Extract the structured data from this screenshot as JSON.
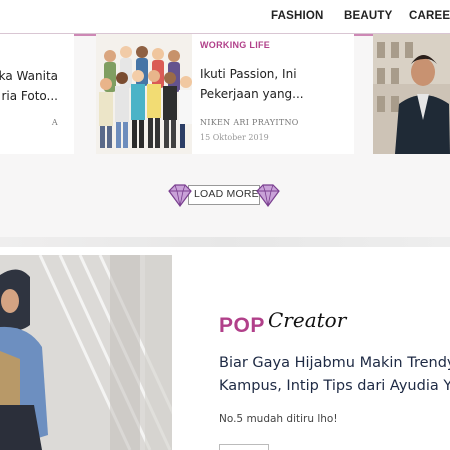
{
  "nav": {
    "items": [
      "FASHION",
      "BEAUTY",
      "CAREER"
    ]
  },
  "cards": {
    "left": {
      "title_line1": "ka Wanita",
      "title_line2": "ria Foto...",
      "author_fragment": "A"
    },
    "middle": {
      "category": "WORKING LIFE",
      "title_line1": "Ikuti Passion, Ini",
      "title_line2": "Pekerjaan yang...",
      "author": "NIKEN ARI PRAYITNO",
      "date": "15 Oktober 2019"
    }
  },
  "load_more": {
    "label": "LOAD MORE"
  },
  "feature": {
    "logo_pop": "POP",
    "logo_creator": "Creator",
    "title_line1": "Biar Gaya Hijabmu Makin Trendy",
    "title_line2": "Kampus, Intip Tips dari Ayudia Yu",
    "subtitle": "No.5 mudah ditiru lho!"
  },
  "colors": {
    "accent": "#b1408a",
    "title_navy": "#1e2a44"
  },
  "icons": {
    "load_more_left": "diamond-icon",
    "load_more_right": "diamond-icon"
  }
}
